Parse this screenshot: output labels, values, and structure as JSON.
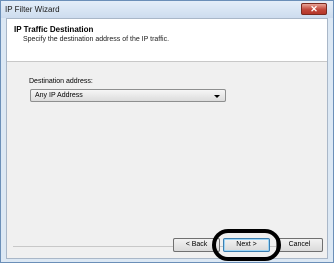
{
  "window": {
    "title": "IP Filter Wizard",
    "close_glyph": "✕"
  },
  "header": {
    "title": "IP Traffic Destination",
    "subtitle": "Specify the destination address of the IP traffic."
  },
  "form": {
    "destination_label": "Destination address:",
    "destination_value": "Any IP Address"
  },
  "buttons": {
    "back_label": "< Back",
    "next_label": "Next >",
    "cancel_label": "Cancel"
  },
  "colors": {
    "close_button": "#c2473a",
    "highlight_ring": "#000000"
  },
  "icons": {
    "close": "close-icon",
    "dropdown": "chevron-down-icon"
  }
}
